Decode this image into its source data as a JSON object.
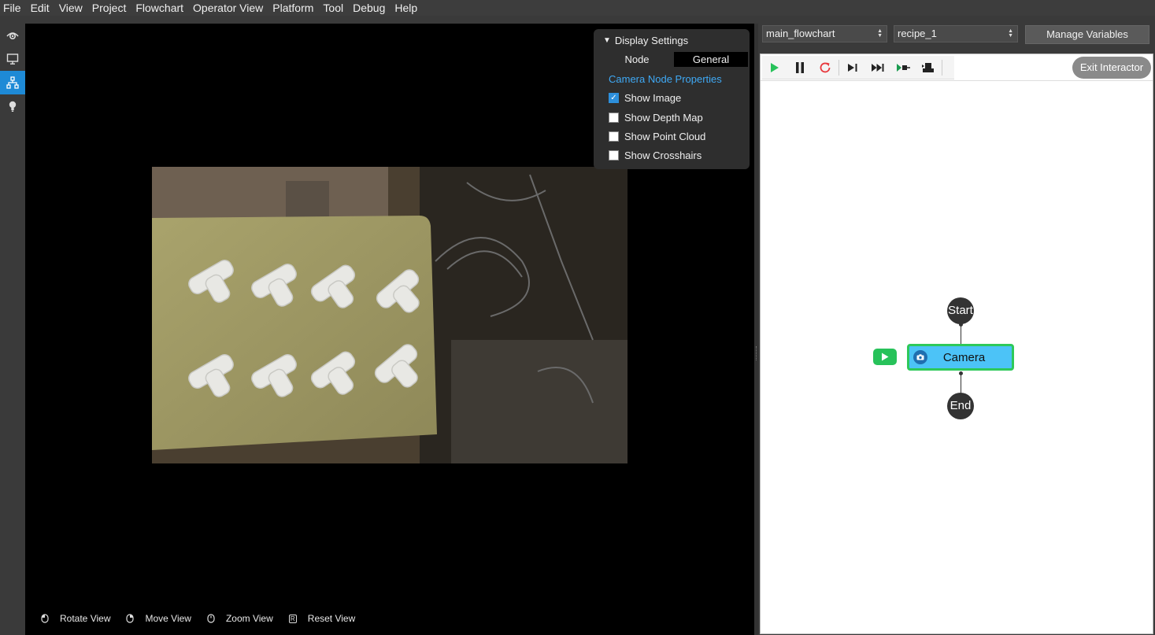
{
  "menubar": {
    "items": [
      "File",
      "Edit",
      "View",
      "Project",
      "Flowchart",
      "Operator View",
      "Platform",
      "Tool",
      "Debug",
      "Help"
    ]
  },
  "toolstrip": {
    "items": [
      {
        "icon": "eye-icon",
        "active": false
      },
      {
        "icon": "monitor-icon",
        "active": false
      },
      {
        "icon": "flowchart-icon",
        "active": true
      },
      {
        "icon": "lightbulb-icon",
        "active": false
      }
    ]
  },
  "display_settings": {
    "title": "Display Settings",
    "tabs": [
      "Node",
      "General"
    ],
    "active_tab": "General",
    "section_title": "Camera Node Properties",
    "options": [
      {
        "label": "Show Image",
        "checked": true
      },
      {
        "label": "Show Depth Map",
        "checked": false
      },
      {
        "label": "Show Point Cloud",
        "checked": false
      },
      {
        "label": "Show Crosshairs",
        "checked": false
      }
    ]
  },
  "view_hints": [
    {
      "icon": "mouse-left-icon",
      "label": "Rotate View"
    },
    {
      "icon": "mouse-right-icon",
      "label": "Move View"
    },
    {
      "icon": "mouse-scroll-icon",
      "label": "Zoom View"
    },
    {
      "icon": "r-key-icon",
      "key": "R",
      "label": "Reset View"
    }
  ],
  "right_panel": {
    "flowchart_select": "main_flowchart",
    "recipe_select": "recipe_1",
    "manage_variables": "Manage Variables",
    "exit_interactor": "Exit Interactor",
    "toolbar": [
      "play-icon",
      "pause-icon",
      "restart-icon",
      "step-icon",
      "fast-forward-icon",
      "step-into-icon",
      "camera-step-icon"
    ]
  },
  "flowchart": {
    "start_label": "Start",
    "camera_label": "Camera",
    "end_label": "End"
  },
  "colors": {
    "accent_blue": "#1e8ad6",
    "node_fill": "#4cc3f7",
    "node_border": "#2ec95a",
    "play_green": "#27c25a",
    "restart_red": "#e8383d"
  }
}
